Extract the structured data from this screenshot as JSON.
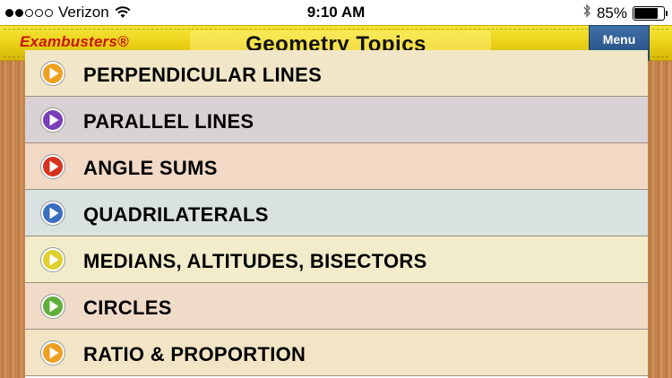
{
  "status_bar": {
    "carrier": "Verizon",
    "time": "9:10 AM",
    "battery_percent": "85%",
    "battery_level": 0.85,
    "signal_bars_filled": 2,
    "signal_bars_total": 5
  },
  "header": {
    "brand": "Exambusters®",
    "title": "Geometry Topics",
    "menu_label": "Menu"
  },
  "colors": {
    "header_yellow": "#e8cf14",
    "brand_red": "#c8140a",
    "menu_blue": "#2d5c96"
  },
  "topics": [
    {
      "label": "PERPENDICULAR LINES",
      "bg": "#f1e7c8",
      "icon": "play-icon",
      "icon_color": "#f0a020"
    },
    {
      "label": "PARALLEL LINES",
      "bg": "#d9d2d4",
      "icon": "play-icon",
      "icon_color": "#7a3fb8"
    },
    {
      "label": "ANGLE SUMS",
      "bg": "#f2d9c6",
      "icon": "play-icon",
      "icon_color": "#d6321e"
    },
    {
      "label": "QUADRILATERALS",
      "bg": "#d9e2e0",
      "icon": "play-icon",
      "icon_color": "#3a6fc0"
    },
    {
      "label": "MEDIANS, ALTITUDES, BISECTORS",
      "bg": "#f3eccb",
      "icon": "play-icon",
      "icon_color": "#e0d030"
    },
    {
      "label": "CIRCLES",
      "bg": "#f0dac8",
      "icon": "play-icon",
      "icon_color": "#5fae3a"
    },
    {
      "label": "RATIO & PROPORTION",
      "bg": "#f2e5c6",
      "icon": "play-icon",
      "icon_color": "#f0a020"
    }
  ]
}
